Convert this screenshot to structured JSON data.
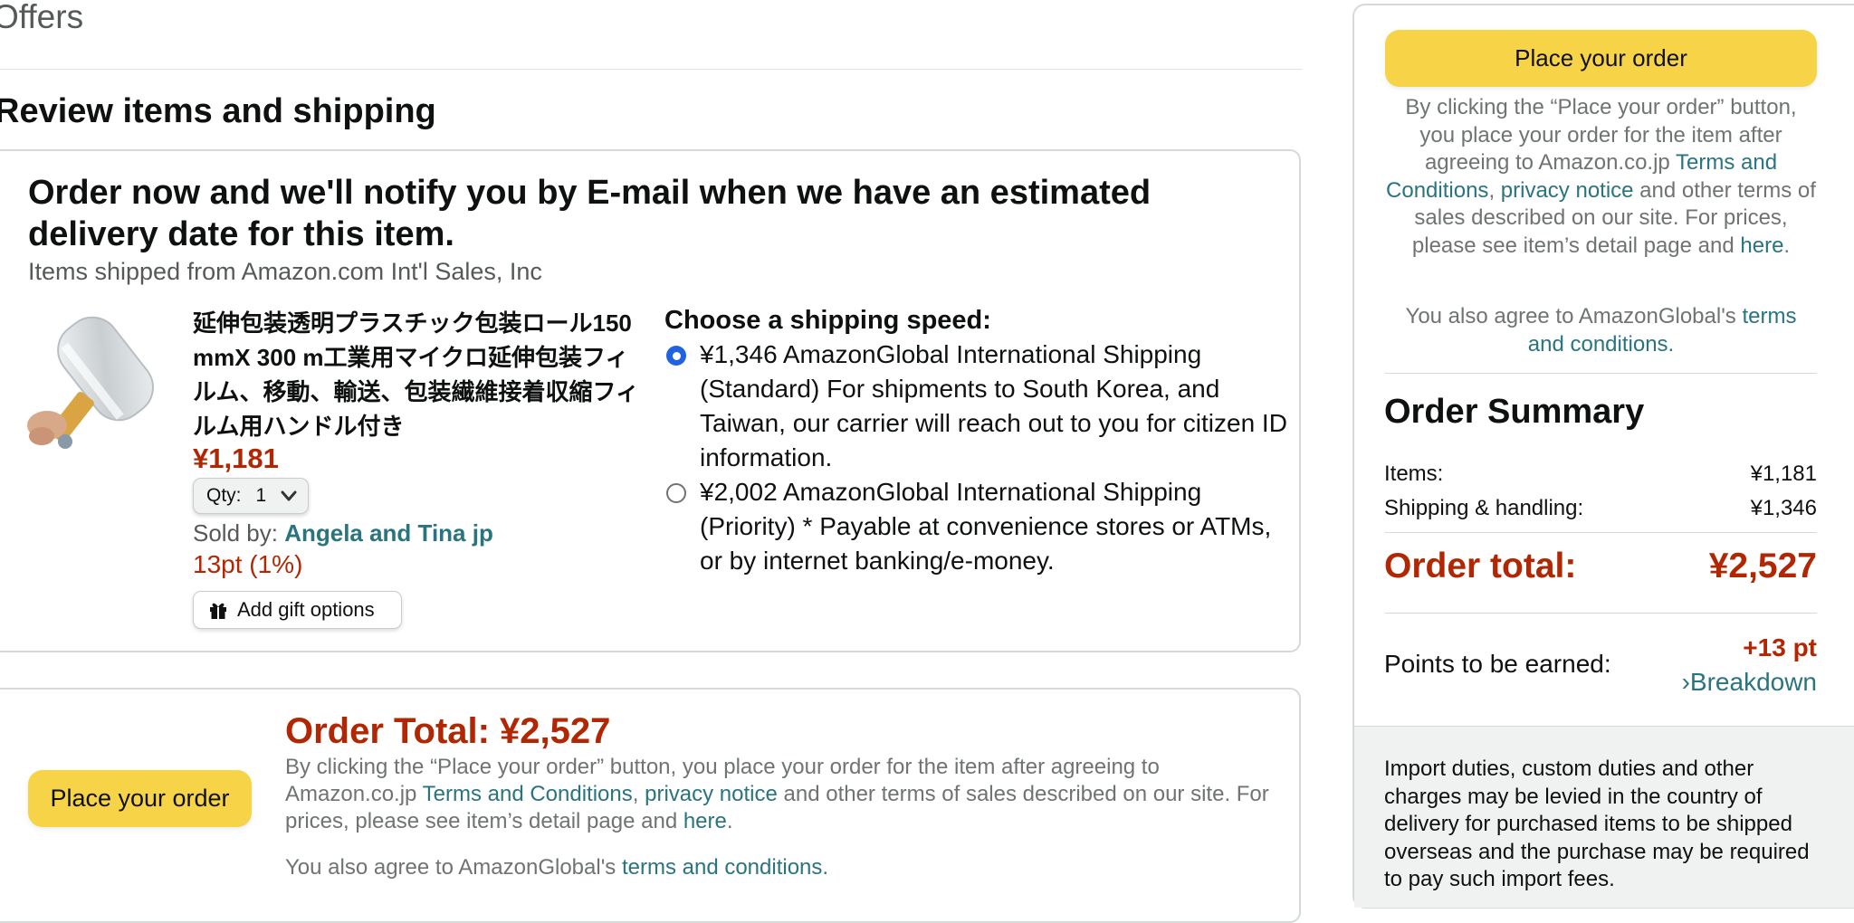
{
  "page": {
    "offers_title": "Offers",
    "review_title": "Review items and shipping"
  },
  "shipment": {
    "notify_heading": "Order now and we'll notify you by E-mail when we have an estimated delivery date for this item.",
    "shipped_from": "Items shipped from Amazon.com Int'l Sales, Inc"
  },
  "product": {
    "title": "延伸包装透明プラスチック包装ロール150 mmX 300 m工業用マイクロ延伸包装フィルム、移動、輸送、包装繊維接着収縮フィルム用ハンドル付き",
    "price": "¥1,181",
    "qty_label": "Qty:",
    "qty_value": "1",
    "sold_by_label": "Sold by:",
    "seller": "Angela and Tina jp",
    "points": "13pt (1%)",
    "gift_label": "Add gift options"
  },
  "shipping": {
    "heading": "Choose a shipping speed:",
    "options": [
      {
        "text": "¥1,346 AmazonGlobal International Shipping (Standard) For shipments to South Korea, and Taiwan, our carrier will reach out to you for citizen ID information.",
        "selected": true
      },
      {
        "text": "¥2,002 AmazonGlobal International Shipping (Priority) * Payable at convenience stores or ATMs, or by internet banking/e-money.",
        "selected": false
      }
    ]
  },
  "bottom": {
    "place_label": "Place your order",
    "order_total": "Order Total: ¥2,527",
    "legal_pre": "By clicking the “Place your order” button, you place your order for the item after agreeing to Amazon.co.jp ",
    "terms_link": "Terms and Conditions",
    "comma": ", ",
    "privacy_link": "privacy notice",
    "legal_mid": " and other terms of sales described on our site. For prices, please see item’s detail page and ",
    "here_link": "here",
    "period": ".",
    "global_pre": "You also agree to AmazonGlobal's ",
    "global_link": "terms and conditions."
  },
  "sidebar": {
    "place_label": "Place your order",
    "legal_pre": "By clicking the “Place your order” button, you place your order for the item after agreeing to Amazon.co.jp ",
    "terms_link": "Terms and Conditions",
    "comma": ", ",
    "privacy_link": "privacy notice",
    "legal_mid": " and other terms of sales described on our site. For prices, please see item’s detail page and ",
    "here_link": "here",
    "period": ".",
    "global_pre": "You also agree to AmazonGlobal's ",
    "global_link": "terms and conditions.",
    "summary_title": "Order Summary",
    "items_label": "Items:",
    "items_value": "¥1,181",
    "shipping_label": "Shipping & handling:",
    "shipping_value": "¥1,346",
    "total_label": "Order total:",
    "total_value": "¥2,527",
    "points_label": "Points to be earned:",
    "points_value": "+13 pt",
    "breakdown_label": "›Breakdown",
    "import_note": "Import duties, custom duties and other charges may be levied in the country of delivery for purchased items to be shipped overseas and the purchase may be required to pay such import fees."
  },
  "colors": {
    "price_red": "#b12704",
    "link_teal": "#2a7480",
    "button_yellow": "#f7d447",
    "radio_blue": "#2162e3"
  },
  "icons": [
    "chevron-down-icon",
    "gift-icon",
    "product-image"
  ]
}
